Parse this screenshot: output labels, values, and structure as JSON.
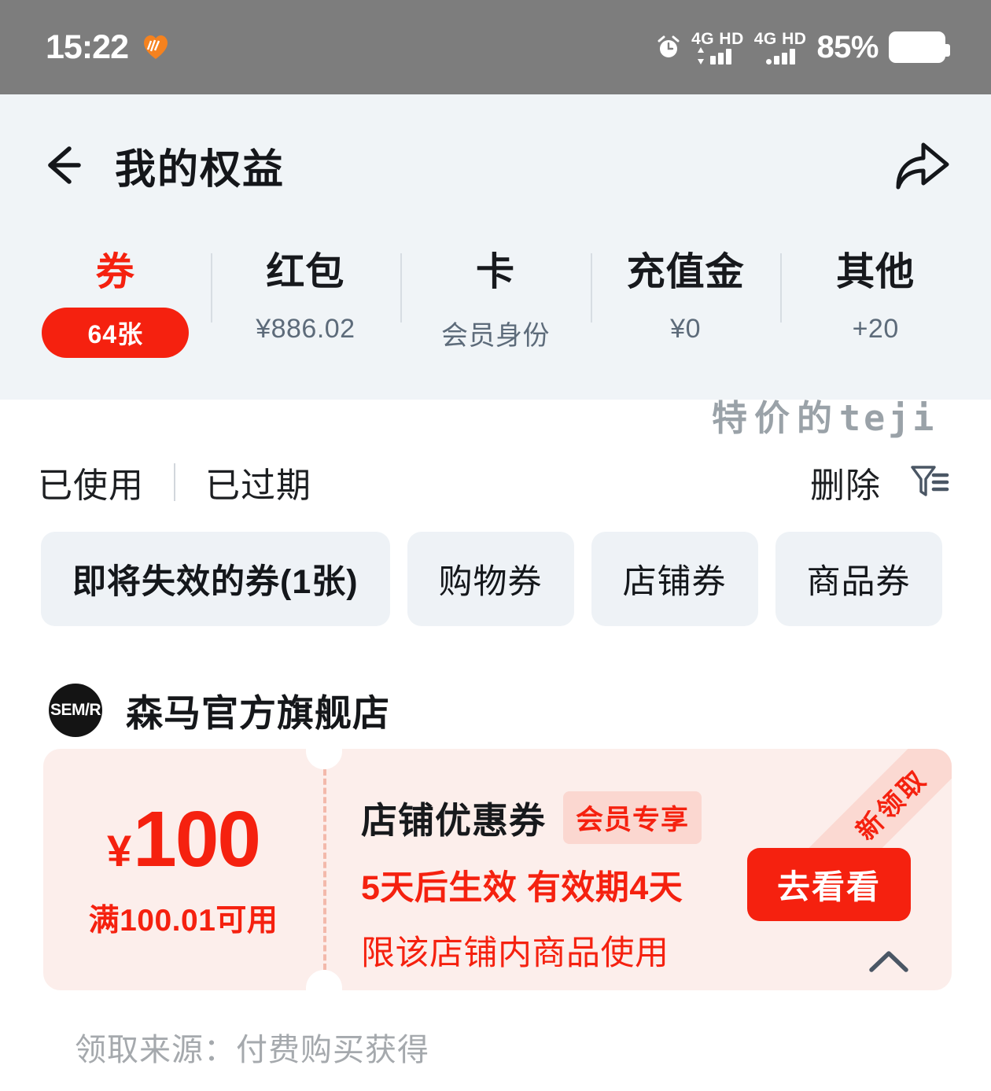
{
  "status_bar": {
    "time": "15:22",
    "heart_icon": "heart-icon",
    "alarm_icon": "alarm-clock-icon",
    "sim1_label": "4G HD",
    "sim2_label": "4G HD",
    "battery_percent": "85%",
    "battery_icon": "battery-icon"
  },
  "header": {
    "back_icon": "back-arrow-icon",
    "title": "我的权益",
    "share_icon": "share-arrow-icon"
  },
  "tabs": [
    {
      "label": "券",
      "badge": "64张",
      "sub": "",
      "active": true
    },
    {
      "label": "红包",
      "badge": "",
      "sub": "¥886.02",
      "active": false
    },
    {
      "label": "卡",
      "badge": "",
      "sub": "会员身份",
      "active": false
    },
    {
      "label": "充值金",
      "badge": "",
      "sub": "¥0",
      "active": false
    },
    {
      "label": "其他",
      "badge": "",
      "sub": "+20",
      "active": false
    }
  ],
  "watermark": {
    "cn": "特价的",
    "en": "teji"
  },
  "filter_row": {
    "used_label": "已使用",
    "expired_label": "已过期",
    "delete_label": "删除",
    "filter_icon": "filter-funnel-icon"
  },
  "chips": [
    {
      "label": "即将失效的券(1张)",
      "selected": true
    },
    {
      "label": "购物券",
      "selected": false
    },
    {
      "label": "店铺券",
      "selected": false
    },
    {
      "label": "商品券",
      "selected": false
    }
  ],
  "shop": {
    "logo_text": "SEM/R",
    "name": "森马官方旗舰店"
  },
  "coupon": {
    "currency": "¥",
    "amount": "100",
    "condition": "满100.01可用",
    "title": "店铺优惠券",
    "tag": "会员专享",
    "validity": "5天后生效 有效期4天",
    "scope": "限该店铺内商品使用",
    "ribbon": "新领取",
    "button_label": "去看看",
    "collapse_icon": "chevron-up-icon"
  },
  "footer": {
    "source_text": "领取来源：付费购买获得"
  },
  "colors": {
    "accent_red": "#f5210f",
    "status_bar_bg": "#7d7d7d",
    "header_bg": "#f0f4f7",
    "coupon_bg": "#fceeeb",
    "chip_bg": "#eef2f6"
  }
}
